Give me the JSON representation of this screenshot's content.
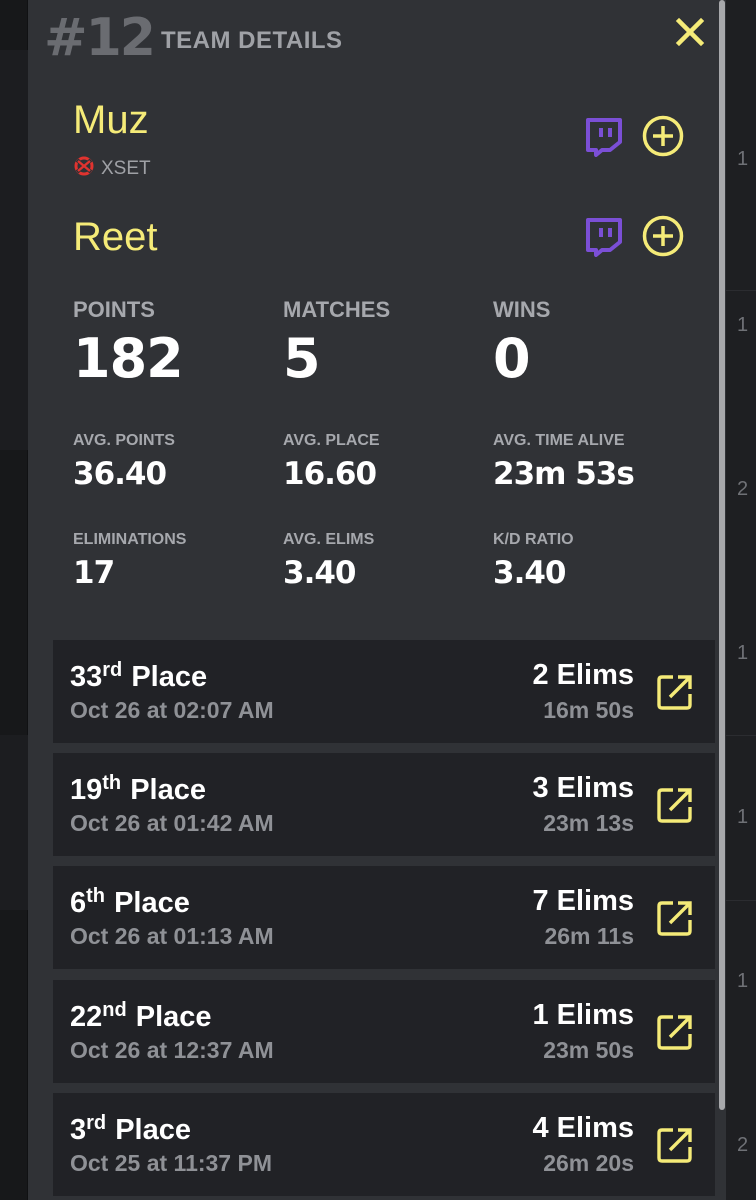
{
  "header": {
    "rank": "#12",
    "title": "TEAM DETAILS"
  },
  "players": [
    {
      "name": "Muz",
      "team": "XSET"
    },
    {
      "name": "Reet"
    }
  ],
  "stats": {
    "points_label": "POINTS",
    "points": "182",
    "matches_label": "MATCHES",
    "matches": "5",
    "wins_label": "WINS",
    "wins": "0",
    "avg_points_label": "AVG. POINTS",
    "avg_points": "36.40",
    "avg_place_label": "AVG. PLACE",
    "avg_place": "16.60",
    "avg_time_label": "AVG. TIME ALIVE",
    "avg_time": "23m 53s",
    "elims_label": "ELIMINATIONS",
    "elims": "17",
    "avg_elims_label": "AVG. ELIMS",
    "avg_elims": "3.40",
    "kd_label": "K/D RATIO",
    "kd": "3.40"
  },
  "matches": [
    {
      "place_num": "33",
      "place_suffix": "rd",
      "place_word": "Place",
      "date": "Oct 26 at 02:07 AM",
      "elims": "2 Elims",
      "time": "16m 50s"
    },
    {
      "place_num": "19",
      "place_suffix": "th",
      "place_word": "Place",
      "date": "Oct 26 at 01:42 AM",
      "elims": "3 Elims",
      "time": "23m 13s"
    },
    {
      "place_num": "6",
      "place_suffix": "th",
      "place_word": "Place",
      "date": "Oct 26 at 01:13 AM",
      "elims": "7 Elims",
      "time": "26m 11s"
    },
    {
      "place_num": "22",
      "place_suffix": "nd",
      "place_word": "Place",
      "date": "Oct 26 at 12:37 AM",
      "elims": "1 Elims",
      "time": "23m 50s"
    },
    {
      "place_num": "3",
      "place_suffix": "rd",
      "place_word": "Place",
      "date": "Oct 25 at 11:37 PM",
      "elims": "4 Elims",
      "time": "26m 20s"
    }
  ],
  "background_edge_digits": [
    "1",
    "1",
    "2",
    "1",
    "1",
    "1",
    "2"
  ],
  "icons": {
    "close": "close-icon",
    "twitch": "twitch-icon",
    "add": "plus-circle-icon",
    "open": "external-link-icon",
    "team_logo": "xset-logo-icon"
  },
  "colors": {
    "accent": "#f5eb78",
    "twitch": "#7b4fd6",
    "panel": "#303236",
    "card": "#212226",
    "muted": "#a6a8ad"
  }
}
